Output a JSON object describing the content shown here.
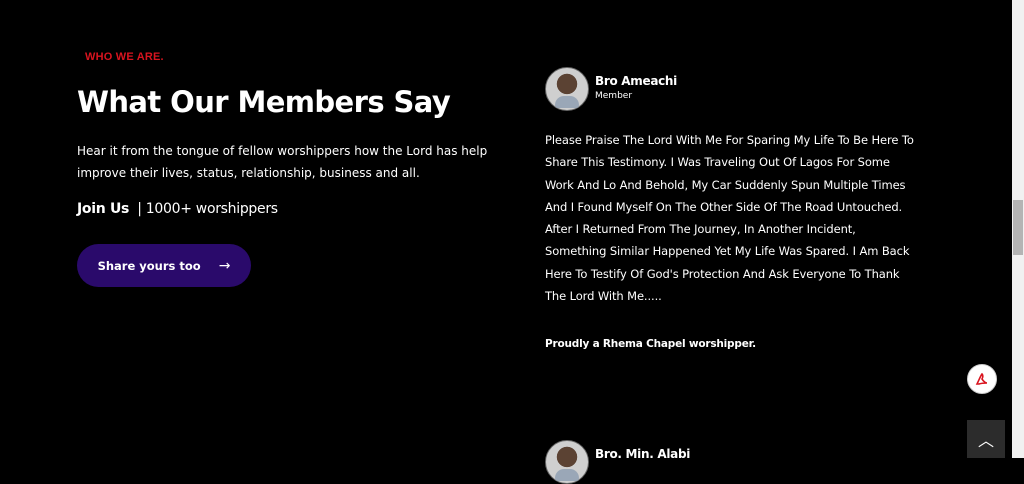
{
  "section": {
    "eyebrow": "WHO WE ARE.",
    "title": "What Our Members Say",
    "lead": "Hear it from the tongue of fellow worshippers how the Lord has help improve their lives, status, relationship, business and all.",
    "join_label": "Join Us",
    "join_count": "| 1000+ worshippers",
    "cta_label": "Share yours too"
  },
  "testimonials": [
    {
      "name": "Bro Ameachi",
      "role": "Member",
      "text": "Please Praise The Lord With Me For Sparing My Life To Be Here To Share This Testimony. I Was Traveling Out Of Lagos For Some Work And Lo And Behold, My Car Suddenly Spun Multiple Times And I Found Myself On The Other Side Of The Road Untouched. After I Returned From The Journey, In Another Incident, Something Similar Happened Yet My Life Was Spared. I Am Back Here To Testify Of God's Protection And Ask Everyone To Thank The Lord With Me.....",
      "footer": "Proudly a Rhema Chapel worshipper."
    },
    {
      "name": "Bro. Min. Alabi"
    }
  ],
  "icons": {
    "cta": "arrow-right-icon",
    "pdf": "pdf-icon",
    "top": "chevron-up-icon"
  },
  "colors": {
    "accent": "#d9141f",
    "button": "#2a0a6b",
    "background": "#000000"
  }
}
